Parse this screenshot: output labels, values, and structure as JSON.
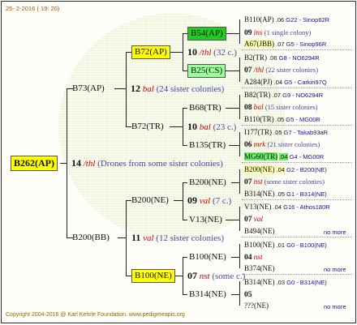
{
  "date": "25-  2-2016 ( 19: 20)",
  "copyright": "Copyright 2004-2016 @ Karl Kehrle Foundation.   www.pedigreeapis.org",
  "root": "B262(AP)",
  "root_link": {
    "num": "14",
    "name": "/thl",
    "note": "(Drones from some sister colonies)"
  },
  "gen1": [
    {
      "id": "B73(AP)",
      "link": {
        "num": "12",
        "name": "bal",
        "note": "(24 sister colonies)"
      }
    },
    {
      "id": "B200(BB)",
      "link": {
        "num": "11",
        "name": "val",
        "note": "(12 sister colonies)"
      }
    }
  ],
  "gen2": [
    {
      "id": "B72(AP)",
      "link": {
        "num": "10",
        "name": "/thl",
        "note": "(32 c.)"
      }
    },
    {
      "id": "B72(TR)",
      "link": {
        "num": "10",
        "name": "bal",
        "note": "(23 c.)"
      }
    },
    {
      "id": "B200(NE)",
      "link": {
        "num": "09",
        "name": "val",
        "note": "(7 c.)"
      }
    },
    {
      "id": "B100(NE)",
      "link": {
        "num": "07",
        "name": "nst",
        "note": "(some c.)"
      }
    }
  ],
  "gen3": [
    {
      "id": "B54(AP)"
    },
    {
      "id": "B25(CS)"
    },
    {
      "id": "B68(TR)"
    },
    {
      "id": "B135(TR)"
    },
    {
      "id": "B200(NE)"
    },
    {
      "id": "V13(NE)"
    },
    {
      "id": "B100(NE)"
    },
    {
      "id": "B314(NE)"
    }
  ],
  "gen4": [
    {
      "rows": [
        {
          "id": "B110(AP)",
          "yr": ".06",
          "code": "G22 - Sinop62R"
        },
        {
          "num": "09",
          "name": "ins",
          "note": "(1 single colony)"
        },
        {
          "id": "A67(JBB)",
          "yr": ".07",
          "code": "G5 - Sinop96R"
        }
      ]
    },
    {
      "rows": [
        {
          "id": "B2(TR)",
          "yr": ".06",
          "code": "G8 - NO6294R"
        },
        {
          "num": "07",
          "name": "/thl",
          "note": "(22 sister colonies)"
        },
        {
          "id": "A284(PJ)",
          "yr": ".04",
          "code": "G5 - Carkiri97Q"
        }
      ]
    },
    {
      "rows": [
        {
          "id": "B82(TR)",
          "yr": ".07",
          "code": "G9 - NO6294R"
        },
        {
          "num": "08",
          "name": "bal",
          "note": "(15 sister colonies)"
        },
        {
          "id": "B110(TR)",
          "yr": ".05",
          "code": "G5 - MG00R"
        }
      ]
    },
    {
      "rows": [
        {
          "id": "I177(TR)",
          "yr": ".05",
          "code": "G7 - Takab93aR"
        },
        {
          "num": "06",
          "name": "mrk",
          "note": "(21 sister colonies)"
        },
        {
          "id": "MG60(TR)",
          "yr": ".04",
          "code": "G4 - MG00R"
        }
      ]
    },
    {
      "rows": [
        {
          "id": "B200(NE)",
          "yr": ".04",
          "code": "G2 - B200(NE)"
        },
        {
          "num": "07",
          "name": "nst",
          "note": "(some sister colonies)"
        },
        {
          "id": "B314(NE)",
          "yr": ".05",
          "code": "G1 - B314(NE)"
        }
      ]
    },
    {
      "rows": [
        {
          "id": "V13(NE)",
          "yr": ".04",
          "code": "G16 - Athos180R"
        },
        {
          "num": "07",
          "name": "val",
          "note": ""
        },
        {
          "id": "B494(NE)",
          "yr": "",
          "code": "",
          "more": "no more"
        }
      ]
    },
    {
      "rows": [
        {
          "id": "B100(NE)",
          "yr": ".01",
          "code": "G0 - B100(NE)"
        },
        {
          "num": "04",
          "name": "nst",
          "note": ""
        },
        {
          "id": "B374(NE)",
          "yr": "",
          "code": "",
          "more": "no more"
        }
      ]
    },
    {
      "rows": [
        {
          "id": "B314(NE)",
          "yr": ".03",
          "code": "G0 - B314(NE)"
        },
        {
          "num": "05",
          "name": "",
          "note": ""
        },
        {
          "id": "???(NE)",
          "yr": "",
          "code": "",
          "more": "no more"
        }
      ]
    }
  ],
  "colors": {
    "yellow": "#ffff00",
    "green": "#22cc22",
    "light_green": "#99ff99",
    "worker_name": "#d00000",
    "sister_note": "#5040a0",
    "code": "#1010a0"
  }
}
